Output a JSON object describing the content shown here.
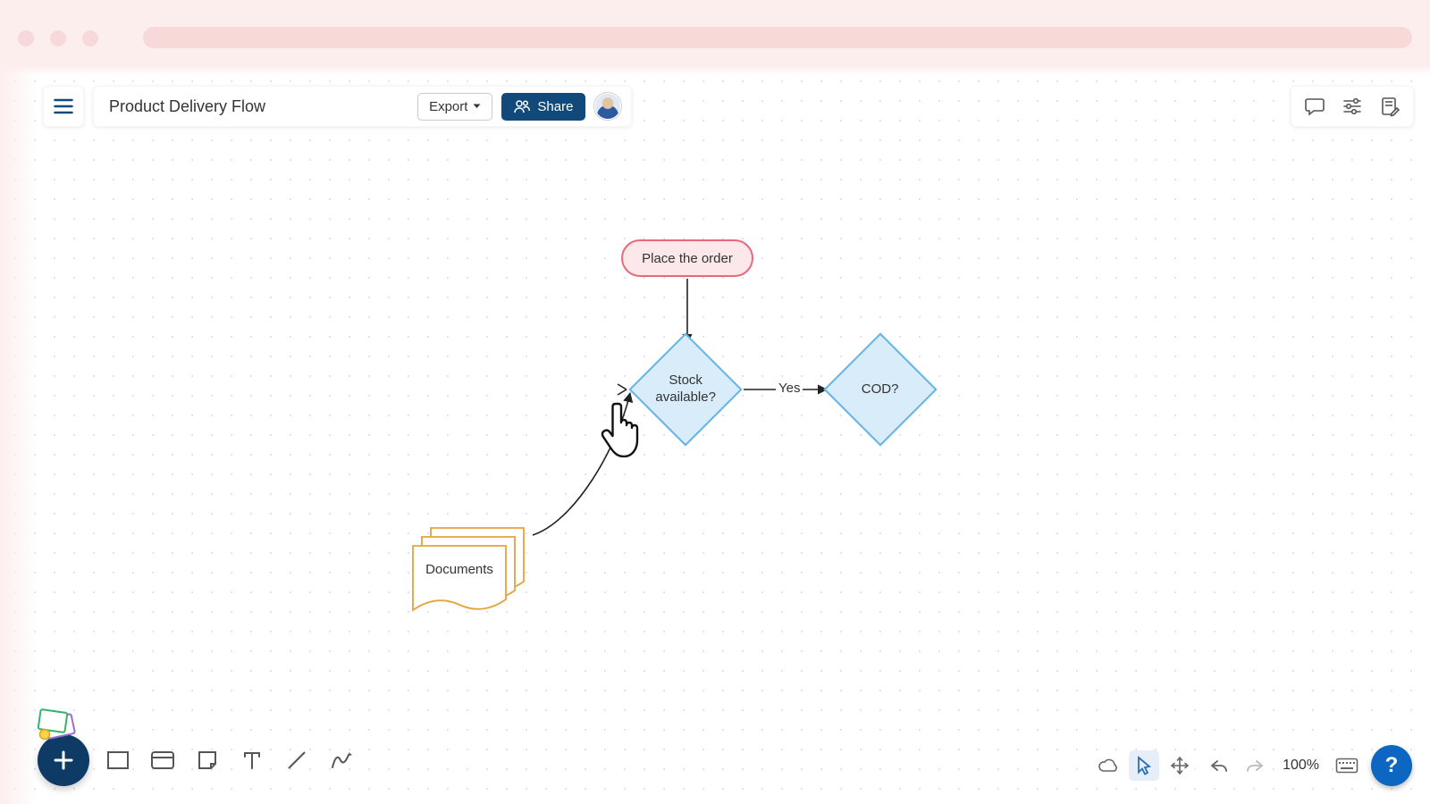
{
  "header": {
    "title": "Product Delivery Flow",
    "export_label": "Export",
    "share_label": "Share"
  },
  "flow": {
    "start_label": "Place the order",
    "decision1_label": "Stock available?",
    "decision2_label": "COD?",
    "edge_yes": "Yes",
    "documents_label": "Documents"
  },
  "zoom_label": "100%",
  "help_label": "?",
  "colors": {
    "pink_stroke": "#e86a79",
    "blue_stroke": "#64b5e6",
    "doc_stroke": "#e6a23c",
    "share_blue": "#11497a",
    "help_blue": "#0d66c2"
  }
}
